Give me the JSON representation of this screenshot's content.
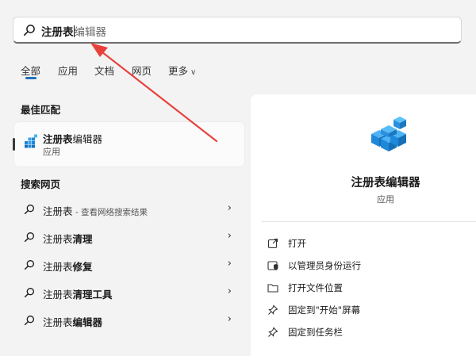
{
  "search": {
    "typed": "注册表",
    "suggestion": "编辑器"
  },
  "tabs": [
    "全部",
    "应用",
    "文档",
    "网页",
    "更多"
  ],
  "best_match": {
    "title": "最佳匹配",
    "name_bold": "注册表",
    "name_rest": "编辑器",
    "type": "应用"
  },
  "web_search": {
    "title": "搜索网页",
    "items": [
      {
        "prefix": "注册表",
        "bold": "",
        "hint": " - 查看网络搜索结果"
      },
      {
        "prefix": "注册表",
        "bold": "清理",
        "hint": ""
      },
      {
        "prefix": "注册表",
        "bold": "修复",
        "hint": ""
      },
      {
        "prefix": "注册表",
        "bold": "清理工具",
        "hint": ""
      },
      {
        "prefix": "注册表",
        "bold": "编辑器",
        "hint": ""
      }
    ]
  },
  "detail": {
    "name": "注册表编辑器",
    "type": "应用",
    "actions": [
      {
        "label": "打开",
        "icon": "open-icon"
      },
      {
        "label": "以管理员身份运行",
        "icon": "shield-icon"
      },
      {
        "label": "打开文件位置",
        "icon": "folder-icon"
      },
      {
        "label": "固定到\"开始\"屏幕",
        "icon": "pin-icon"
      },
      {
        "label": "固定到任务栏",
        "icon": "pin-icon"
      }
    ]
  },
  "colors": {
    "accent": "#1f6fbf",
    "annotation_arrow": "#e8413c",
    "icon_blue": "#1e88d9"
  }
}
